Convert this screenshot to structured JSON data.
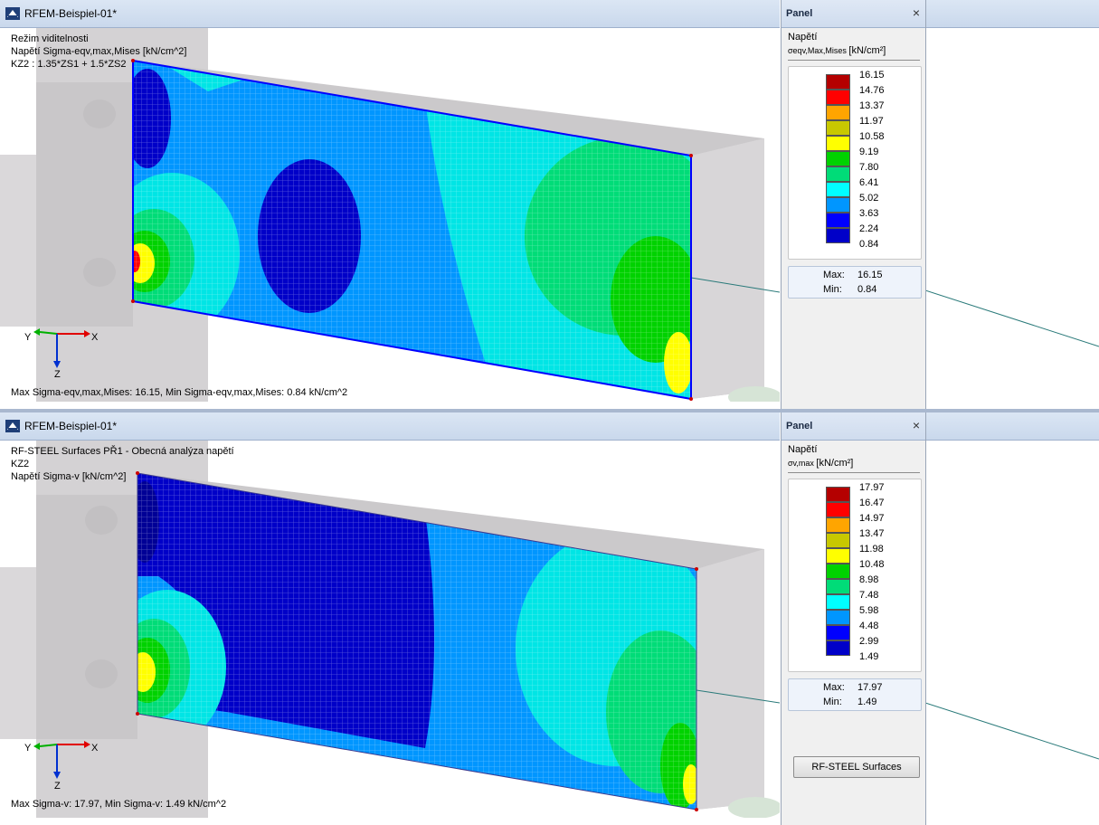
{
  "top": {
    "window_title": "RFEM-Beispiel-01*",
    "info_lines": [
      "Režim viditelnosti",
      "Napětí Sigma-eqv,max,Mises [kN/cm^2]",
      "KZ2 : 1.35*ZS1 + 1.5*ZS2"
    ],
    "bottom_info": "Max Sigma-eqv,max,Mises: 16.15, Min Sigma-eqv,max,Mises: 0.84 kN/cm^2",
    "axes": {
      "x": "X",
      "y": "Y",
      "z": "Z"
    },
    "panel": {
      "title": "Panel",
      "close": "×",
      "result_title": "Napětí",
      "result_symbol": "σeqv,Max,Mises",
      "result_unit": "[kN/cm²]",
      "scale_values": [
        "16.15",
        "14.76",
        "13.37",
        "11.97",
        "10.58",
        "9.19",
        "7.80",
        "6.41",
        "5.02",
        "3.63",
        "2.24",
        "0.84"
      ],
      "max_label": "Max:",
      "max_value": "16.15",
      "min_label": "Min:",
      "min_value": "0.84"
    }
  },
  "bottom": {
    "window_title": "RFEM-Beispiel-01*",
    "info_lines": [
      "RF-STEEL Surfaces PŘ1 - Obecná analýza napětí",
      "KZ2",
      "Napětí Sigma-v [kN/cm^2]"
    ],
    "bottom_info": "Max Sigma-v: 17.97, Min Sigma-v: 1.49 kN/cm^2",
    "axes": {
      "x": "X",
      "y": "Y",
      "z": "Z"
    },
    "panel": {
      "title": "Panel",
      "close": "×",
      "result_title": "Napětí",
      "result_symbol": "σv,max",
      "result_unit": "[kN/cm²]",
      "scale_values": [
        "17.97",
        "16.47",
        "14.97",
        "13.47",
        "11.98",
        "10.48",
        "8.98",
        "7.48",
        "5.98",
        "4.48",
        "2.99",
        "1.49"
      ],
      "max_label": "Max:",
      "max_value": "17.97",
      "min_label": "Min:",
      "min_value": "1.49",
      "button_label": "RF-STEEL Surfaces"
    }
  },
  "colors": {
    "scale": [
      "#b40000",
      "#ff0000",
      "#ffa500",
      "#c8c800",
      "#ffff00",
      "#00d200",
      "#00dc78",
      "#00ffff",
      "#0096ff",
      "#0000ff",
      "#0000c8",
      "#000096"
    ],
    "titlebar": "#c9d8ec",
    "panel_bg": "#f0f0f0"
  },
  "icons": [
    "app-logo-icon",
    "close-icon",
    "axis-triad-icon"
  ]
}
